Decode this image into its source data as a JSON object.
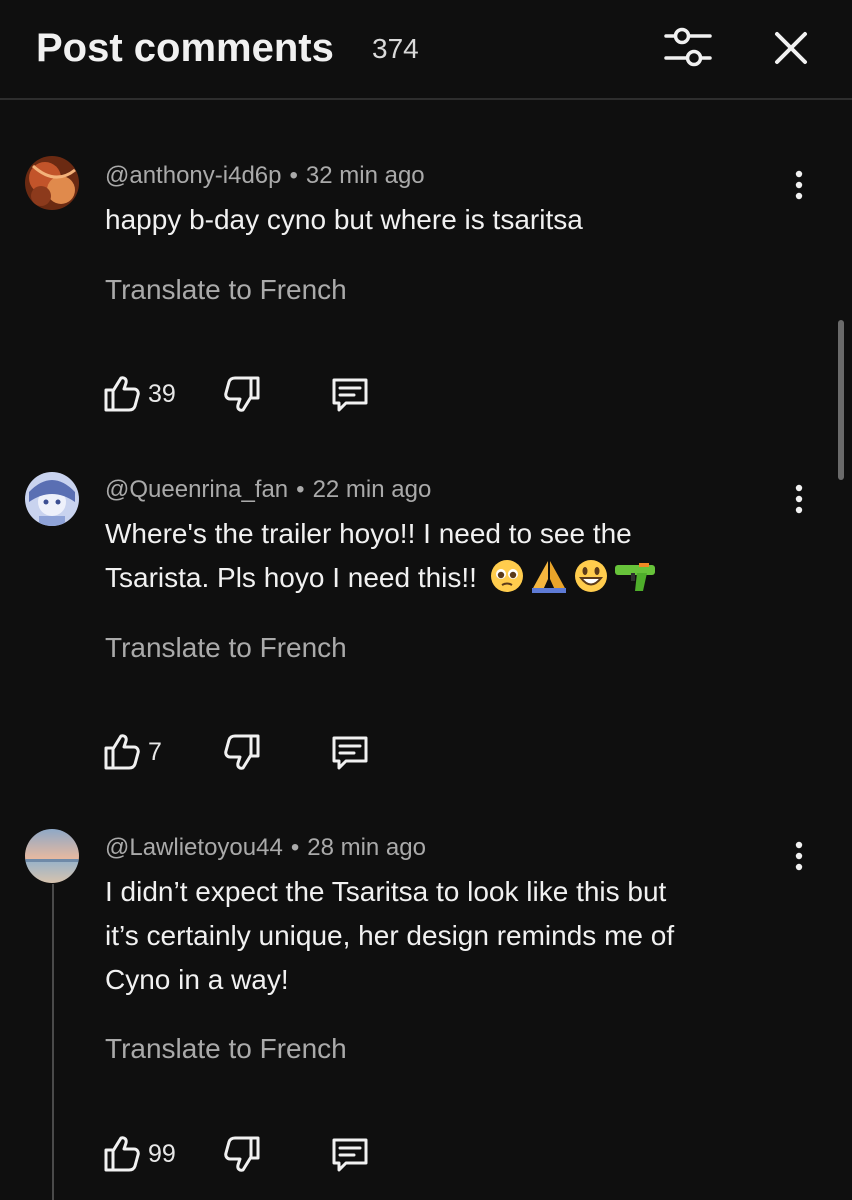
{
  "header": {
    "title": "Post comments",
    "count": "374",
    "filter_icon": "sliders-icon",
    "close_icon": "close-icon"
  },
  "comments": [
    {
      "author": "@anthony-i4d6p",
      "time": "32 min ago",
      "text": "happy b-day cyno but where is tsaritsa",
      "translate": "Translate to French",
      "likes": "39"
    },
    {
      "author": "@Queenrina_fan",
      "time": "22 min ago",
      "text_line1": "Where's the trailer hoyo!! I need to see the",
      "text_line2": "Tsarista. Pls hoyo I need this!!",
      "emojis": [
        "pleading-face-emoji",
        "folded-hands-emoji",
        "grinning-face-emoji",
        "water-pistol-emoji"
      ],
      "translate": "Translate to French",
      "likes": "7"
    },
    {
      "author": "@Lawlietoyou44",
      "time": "28 min ago",
      "text_line1": "I didn’t expect the Tsaritsa to look like this but",
      "text_line2": "it’s certainly unique, her design reminds me of",
      "text_line3": "Cyno in a way!",
      "translate": "Translate to French",
      "likes": "99"
    }
  ],
  "colors": {
    "background": "#0f0f0f",
    "text_primary": "#f1f1f1",
    "text_secondary": "#aaaaaa",
    "divider": "#2e2e2e"
  }
}
